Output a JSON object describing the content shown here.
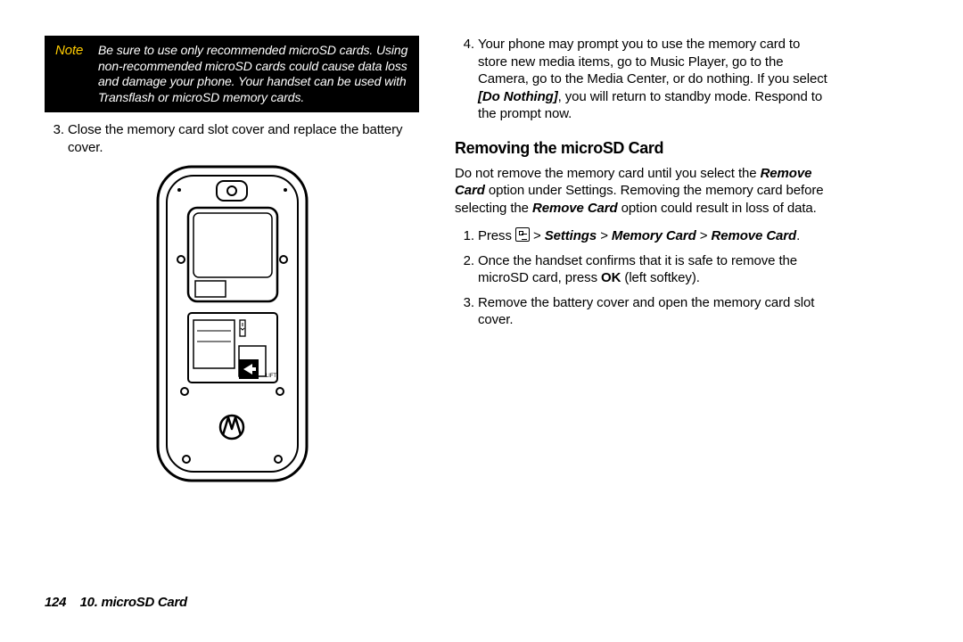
{
  "note": {
    "label": "Note",
    "text": "Be sure to use only recommended microSD cards. Using non-recommended microSD cards could cause data loss and damage your phone. Your handset can be used with Transflash or microSD memory cards."
  },
  "left": {
    "item3": "Close the memory card slot cover and replace the battery cover."
  },
  "right": {
    "item4_a": "Your phone may prompt you to use the memory card to store new media items, go to Music Player, go to the Camera, go to the Media Center, or do nothing. If you select ",
    "item4_bold": "[Do Nothing]",
    "item4_b": ", you will return to standby mode. Respond to the prompt now.",
    "heading": "Removing the microSD Card",
    "para_a": "Do not remove the memory card until you select the ",
    "para_b1": "Remove Card",
    "para_c": " option under Settings. Removing the memory card before selecting the ",
    "para_b2": "Remove Card",
    "para_d": " option could result in loss of data.",
    "step1_a": "Press ",
    "step1_b": " > ",
    "step1_s1": "Settings",
    "step1_s2": "Memory Card",
    "step1_s3": "Remove Card",
    "step1_end": ".",
    "step2_a": "Once the handset confirms that it is safe to remove the microSD card, press ",
    "step2_ok": "OK",
    "step2_b": " (left softkey).",
    "step3": "Remove the battery cover and open the memory card slot cover."
  },
  "footer": {
    "page": "124",
    "chapter": "10. microSD Card"
  }
}
